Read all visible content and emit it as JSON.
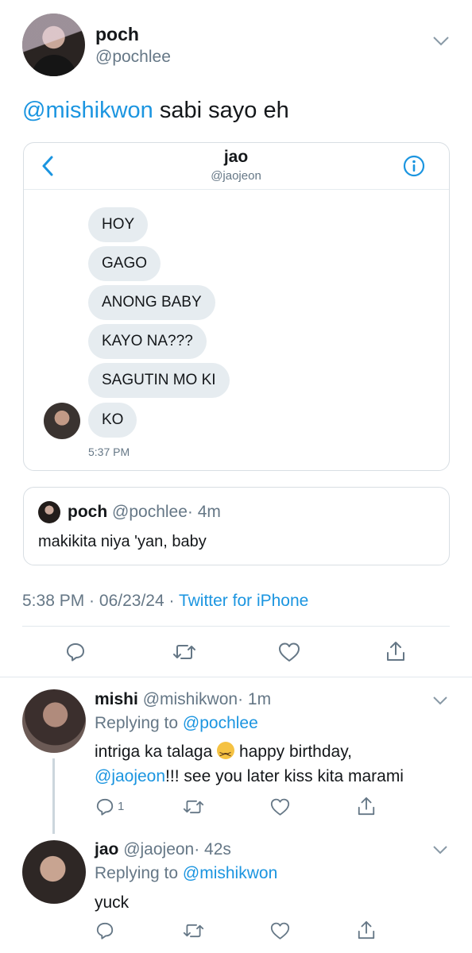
{
  "main_tweet": {
    "name": "poch",
    "handle": "@pochlee",
    "mention": "@mishikwon",
    "text": " sabi sayo eh",
    "meta_time": "5:38 PM",
    "meta_sep1": " · ",
    "meta_date": "06/23/24",
    "meta_sep2": " · ",
    "source": "Twitter for iPhone"
  },
  "dm_screenshot": {
    "name": "jao",
    "handle": "@jaojeon",
    "messages": [
      "HOY",
      "GAGO",
      "ANONG BABY",
      "KAYO NA???",
      "SAGUTIN MO KI",
      "KO"
    ],
    "timestamp": "5:37 PM"
  },
  "quoted_tweet": {
    "name": "poch",
    "handle": "@pochlee",
    "time": "· 4m",
    "text": "makikita niya 'yan, baby"
  },
  "replies": [
    {
      "name": "mishi",
      "handle": "@mishikwon",
      "time": "· 1m",
      "replying_prefix": "Replying to ",
      "replying_to": "@pochlee",
      "text_a": "intriga ka talaga ",
      "emoji": "persevering-face-emoji",
      "text_b": " happy birthday,",
      "mention": "@jaojeon",
      "text_c": "!!! see you later kiss kita marami",
      "reply_count": "1"
    },
    {
      "name": "jao",
      "handle": "@jaojeon",
      "time": "· 42s",
      "replying_prefix": "Replying to ",
      "replying_to": "@mishikwon",
      "text": "yuck"
    }
  ],
  "icons": [
    "chevron-down-icon",
    "back-arrow-icon",
    "info-icon",
    "reply-icon",
    "retweet-icon",
    "like-icon",
    "share-icon"
  ],
  "colors": {
    "link": "#1b95e0",
    "muted": "#657786",
    "bubble": "#e6ecf0"
  }
}
